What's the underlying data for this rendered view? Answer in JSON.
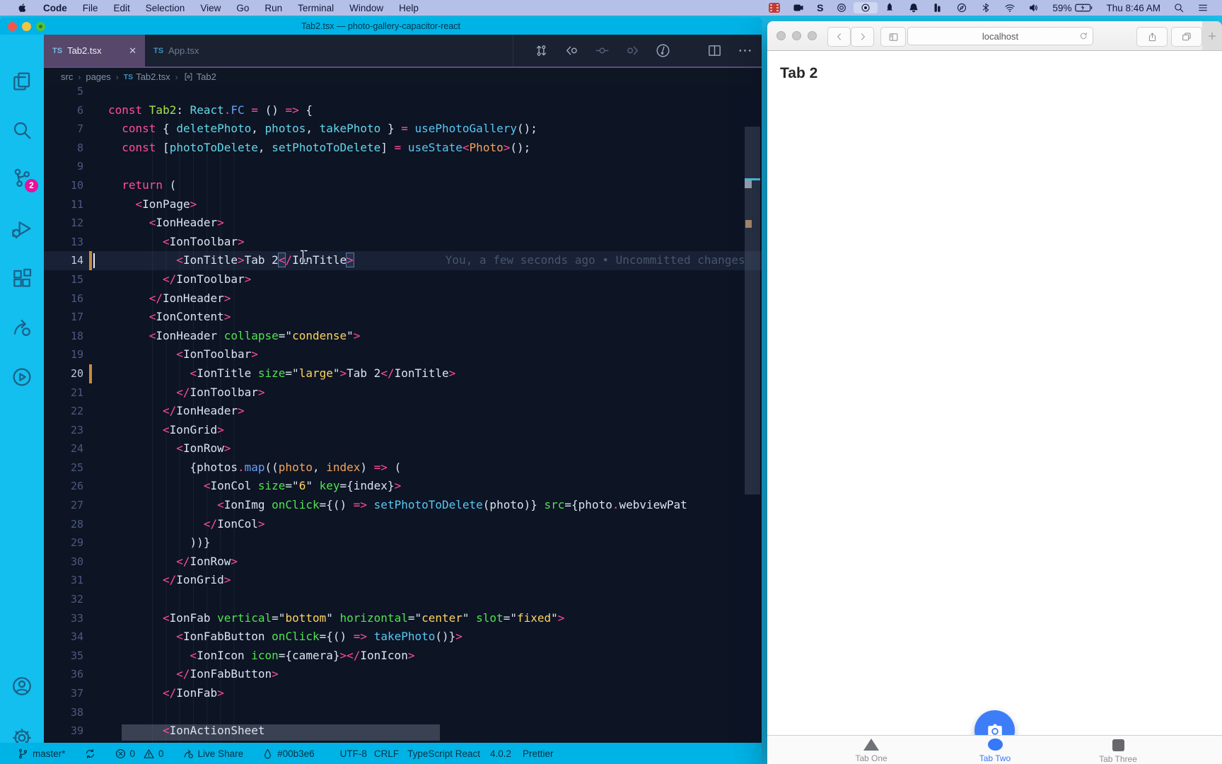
{
  "menu_bar": {
    "app_name": "Code",
    "items": [
      "File",
      "Edit",
      "Selection",
      "View",
      "Go",
      "Run",
      "Terminal",
      "Window",
      "Help"
    ],
    "status_icons": [
      "film-icon",
      "screen-camera-icon",
      "s-logo-icon",
      "disc-icon",
      "screen-record-icon",
      "rocket-icon",
      "bell-icon",
      "meter-icon",
      "compass-icon",
      "bluetooth-icon",
      "wifi-icon",
      "volume-icon"
    ],
    "battery_percent": "59%",
    "clock": "Thu 8:46 AM"
  },
  "vscode": {
    "window_title": "Tab2.tsx — photo-gallery-capacitor-react",
    "tabs": [
      {
        "label": "Tab2.tsx",
        "icon": "TS",
        "active": true,
        "close_label": "✕"
      },
      {
        "label": "App.tsx",
        "icon": "TS",
        "active": false
      }
    ],
    "tab_actions": [
      "compare-changes-icon",
      "previous-change-icon",
      "change-icon",
      "next-change-icon",
      "run-commit-icon",
      "split-editor-icon",
      "more-actions-icon"
    ],
    "breadcrumbs": [
      {
        "label": "src"
      },
      {
        "label": "pages"
      },
      {
        "label": "Tab2.tsx",
        "icon": "TS"
      },
      {
        "label": "Tab2",
        "icon": "symbol"
      }
    ],
    "activity_bar": {
      "top_icons": [
        "explorer-icon",
        "search-icon",
        "source-control-icon",
        "run-debug-icon",
        "extensions-icon",
        "live-share-icon",
        "test-icon"
      ],
      "bottom_icons": [
        "account-icon",
        "settings-gear-icon"
      ],
      "scm_badge": "2"
    },
    "editor": {
      "blame": "You, a few seconds ago • Uncommitted changes",
      "lines": [
        {
          "n": 5,
          "i": 0,
          "t": []
        },
        {
          "n": 6,
          "i": 0,
          "t": [
            [
              "p",
              "const "
            ],
            [
              "l",
              "Tab2"
            ],
            [
              "w",
              ": "
            ],
            [
              "c",
              "React"
            ],
            [
              "p",
              "."
            ],
            [
              "b",
              "FC"
            ],
            [
              "p",
              " = "
            ],
            [
              "w",
              "() "
            ],
            [
              "p",
              "=>"
            ],
            [
              "w",
              " {"
            ]
          ]
        },
        {
          "n": 7,
          "i": 2,
          "t": [
            [
              "p",
              "const "
            ],
            [
              "w",
              "{ "
            ],
            [
              "c",
              "deletePhoto"
            ],
            [
              "w",
              ", "
            ],
            [
              "c",
              "photos"
            ],
            [
              "w",
              ", "
            ],
            [
              "c",
              "takePhoto"
            ],
            [
              "w",
              " } "
            ],
            [
              "p",
              "= "
            ],
            [
              "f",
              "usePhotoGallery"
            ],
            [
              "w",
              "();"
            ]
          ]
        },
        {
          "n": 8,
          "i": 2,
          "t": [
            [
              "p",
              "const "
            ],
            [
              "w",
              "["
            ],
            [
              "c",
              "photoToDelete"
            ],
            [
              "w",
              ", "
            ],
            [
              "c",
              "setPhotoToDelete"
            ],
            [
              "w",
              "] "
            ],
            [
              "p",
              "= "
            ],
            [
              "f",
              "useState"
            ],
            [
              "p",
              "<"
            ],
            [
              "o",
              "Photo"
            ],
            [
              "p",
              ">"
            ],
            [
              "w",
              "();"
            ]
          ]
        },
        {
          "n": 9,
          "i": 0,
          "t": []
        },
        {
          "n": 10,
          "i": 2,
          "t": [
            [
              "p",
              "return"
            ],
            [
              "w",
              " ("
            ]
          ]
        },
        {
          "n": 11,
          "i": 4,
          "t": [
            [
              "p",
              "<"
            ],
            [
              "w",
              "IonPage"
            ],
            [
              "p",
              ">"
            ]
          ]
        },
        {
          "n": 12,
          "i": 6,
          "t": [
            [
              "p",
              "<"
            ],
            [
              "w",
              "IonHeader"
            ],
            [
              "p",
              ">"
            ]
          ]
        },
        {
          "n": 13,
          "i": 8,
          "t": [
            [
              "p",
              "<"
            ],
            [
              "w",
              "IonToolbar"
            ],
            [
              "p",
              ">"
            ]
          ]
        },
        {
          "n": 14,
          "i": 10,
          "cur": 1,
          "mod": 1,
          "caret": 1,
          "blame": 1,
          "t": [
            [
              "p",
              "<"
            ],
            [
              "w",
              "IonTitle"
            ],
            [
              "p",
              ">"
            ],
            [
              "w",
              "Tab 2"
            ],
            [
              "B",
              "<"
            ],
            [
              "p",
              "/"
            ],
            [
              "w",
              "IonTitle"
            ],
            [
              "B",
              ">"
            ]
          ]
        },
        {
          "n": 15,
          "i": 8,
          "t": [
            [
              "p",
              "</"
            ],
            [
              "w",
              "IonToolbar"
            ],
            [
              "p",
              ">"
            ]
          ]
        },
        {
          "n": 16,
          "i": 6,
          "t": [
            [
              "p",
              "</"
            ],
            [
              "w",
              "IonHeader"
            ],
            [
              "p",
              ">"
            ]
          ]
        },
        {
          "n": 17,
          "i": 6,
          "t": [
            [
              "p",
              "<"
            ],
            [
              "w",
              "IonContent"
            ],
            [
              "p",
              ">"
            ]
          ]
        },
        {
          "n": 18,
          "i": 6,
          "t": [
            [
              "p",
              "<"
            ],
            [
              "w",
              "IonHeader "
            ],
            [
              "g",
              "collapse"
            ],
            [
              "w",
              "=\""
            ],
            [
              "y",
              "condense"
            ],
            [
              "w",
              "\""
            ],
            [
              "p",
              ">"
            ]
          ]
        },
        {
          "n": 19,
          "i": 10,
          "t": [
            [
              "p",
              "<"
            ],
            [
              "w",
              "IonToolbar"
            ],
            [
              "p",
              ">"
            ]
          ]
        },
        {
          "n": 20,
          "i": 12,
          "mod": 1,
          "t": [
            [
              "p",
              "<"
            ],
            [
              "w",
              "IonTitle "
            ],
            [
              "g",
              "size"
            ],
            [
              "w",
              "=\""
            ],
            [
              "y",
              "large"
            ],
            [
              "w",
              "\""
            ],
            [
              "p",
              ">"
            ],
            [
              "w",
              "Tab 2"
            ],
            [
              "p",
              "</"
            ],
            [
              "w",
              "IonTitle"
            ],
            [
              "p",
              ">"
            ]
          ]
        },
        {
          "n": 21,
          "i": 10,
          "t": [
            [
              "p",
              "</"
            ],
            [
              "w",
              "IonToolbar"
            ],
            [
              "p",
              ">"
            ]
          ]
        },
        {
          "n": 22,
          "i": 8,
          "t": [
            [
              "p",
              "</"
            ],
            [
              "w",
              "IonHeader"
            ],
            [
              "p",
              ">"
            ]
          ]
        },
        {
          "n": 23,
          "i": 8,
          "t": [
            [
              "p",
              "<"
            ],
            [
              "w",
              "IonGrid"
            ],
            [
              "p",
              ">"
            ]
          ]
        },
        {
          "n": 24,
          "i": 10,
          "t": [
            [
              "p",
              "<"
            ],
            [
              "w",
              "IonRow"
            ],
            [
              "p",
              ">"
            ]
          ]
        },
        {
          "n": 25,
          "i": 12,
          "t": [
            [
              "w",
              "{photos"
            ],
            [
              "p",
              "."
            ],
            [
              "b",
              "map"
            ],
            [
              "w",
              "(("
            ],
            [
              "o",
              "photo"
            ],
            [
              "w",
              ", "
            ],
            [
              "o",
              "index"
            ],
            [
              "w",
              ") "
            ],
            [
              "p",
              "=>"
            ],
            [
              "w",
              " ("
            ]
          ]
        },
        {
          "n": 26,
          "i": 14,
          "t": [
            [
              "p",
              "<"
            ],
            [
              "w",
              "IonCol "
            ],
            [
              "g",
              "size"
            ],
            [
              "w",
              "=\""
            ],
            [
              "y",
              "6"
            ],
            [
              "w",
              "\" "
            ],
            [
              "g",
              "key"
            ],
            [
              "w",
              "={index}"
            ],
            [
              "p",
              ">"
            ]
          ]
        },
        {
          "n": 27,
          "i": 16,
          "t": [
            [
              "p",
              "<"
            ],
            [
              "w",
              "IonImg "
            ],
            [
              "g",
              "onClick"
            ],
            [
              "w",
              "={() "
            ],
            [
              "p",
              "=>"
            ],
            [
              "w",
              " "
            ],
            [
              "f",
              "setPhotoToDelete"
            ],
            [
              "w",
              "(photo)} "
            ],
            [
              "g",
              "src"
            ],
            [
              "w",
              "={photo"
            ],
            [
              "p",
              "."
            ],
            [
              "w",
              "webviewPat"
            ]
          ]
        },
        {
          "n": 28,
          "i": 14,
          "t": [
            [
              "p",
              "</"
            ],
            [
              "w",
              "IonCol"
            ],
            [
              "p",
              ">"
            ]
          ]
        },
        {
          "n": 29,
          "i": 12,
          "t": [
            [
              "w",
              "))}"
            ]
          ]
        },
        {
          "n": 30,
          "i": 10,
          "t": [
            [
              "p",
              "</"
            ],
            [
              "w",
              "IonRow"
            ],
            [
              "p",
              ">"
            ]
          ]
        },
        {
          "n": 31,
          "i": 8,
          "t": [
            [
              "p",
              "</"
            ],
            [
              "w",
              "IonGrid"
            ],
            [
              "p",
              ">"
            ]
          ]
        },
        {
          "n": 32,
          "i": 0,
          "t": []
        },
        {
          "n": 33,
          "i": 8,
          "t": [
            [
              "p",
              "<"
            ],
            [
              "w",
              "IonFab "
            ],
            [
              "g",
              "vertical"
            ],
            [
              "w",
              "=\""
            ],
            [
              "y",
              "bottom"
            ],
            [
              "w",
              "\" "
            ],
            [
              "g",
              "horizontal"
            ],
            [
              "w",
              "=\""
            ],
            [
              "y",
              "center"
            ],
            [
              "w",
              "\" "
            ],
            [
              "g",
              "slot"
            ],
            [
              "w",
              "=\""
            ],
            [
              "y",
              "fixed"
            ],
            [
              "w",
              "\""
            ],
            [
              "p",
              ">"
            ]
          ]
        },
        {
          "n": 34,
          "i": 10,
          "t": [
            [
              "p",
              "<"
            ],
            [
              "w",
              "IonFabButton "
            ],
            [
              "g",
              "onClick"
            ],
            [
              "w",
              "={() "
            ],
            [
              "p",
              "=>"
            ],
            [
              "w",
              " "
            ],
            [
              "f",
              "takePhoto"
            ],
            [
              "w",
              "()}"
            ],
            [
              "p",
              ">"
            ]
          ]
        },
        {
          "n": 35,
          "i": 12,
          "t": [
            [
              "p",
              "<"
            ],
            [
              "w",
              "IonIcon "
            ],
            [
              "g",
              "icon"
            ],
            [
              "w",
              "={camera}"
            ],
            [
              "p",
              "></"
            ],
            [
              "w",
              "IonIcon"
            ],
            [
              "p",
              ">"
            ]
          ]
        },
        {
          "n": 36,
          "i": 10,
          "t": [
            [
              "p",
              "</"
            ],
            [
              "w",
              "IonFabButton"
            ],
            [
              "p",
              ">"
            ]
          ]
        },
        {
          "n": 37,
          "i": 8,
          "t": [
            [
              "p",
              "</"
            ],
            [
              "w",
              "IonFab"
            ],
            [
              "p",
              ">"
            ]
          ]
        },
        {
          "n": 38,
          "i": 0,
          "t": []
        },
        {
          "n": 39,
          "i": 8,
          "t": [
            [
              "p",
              "<"
            ],
            [
              "w",
              "IonActionSheet"
            ]
          ]
        }
      ]
    },
    "status_bar": {
      "branch": "master*",
      "errors": "0",
      "warnings": "0",
      "live_share": "Live Share",
      "peacock_color": "#00b3e6",
      "encoding": "UTF-8",
      "eol": "CRLF",
      "language": "TypeScript React",
      "version": "4.0.2",
      "formatter": "Prettier"
    },
    "colors": {
      "accent": "#00b3e6",
      "active_tab": "#57476b"
    }
  },
  "safari": {
    "url": "localhost",
    "page": {
      "title": "Tab 2",
      "fab_icon": "camera-icon",
      "tabs": [
        {
          "label": "Tab One",
          "icon": "triangle-icon",
          "active": false
        },
        {
          "label": "Tab Two",
          "icon": "circle-icon",
          "active": true
        },
        {
          "label": "Tab Three",
          "icon": "square-icon",
          "active": false
        }
      ]
    },
    "accent": "#3d7ef8"
  }
}
